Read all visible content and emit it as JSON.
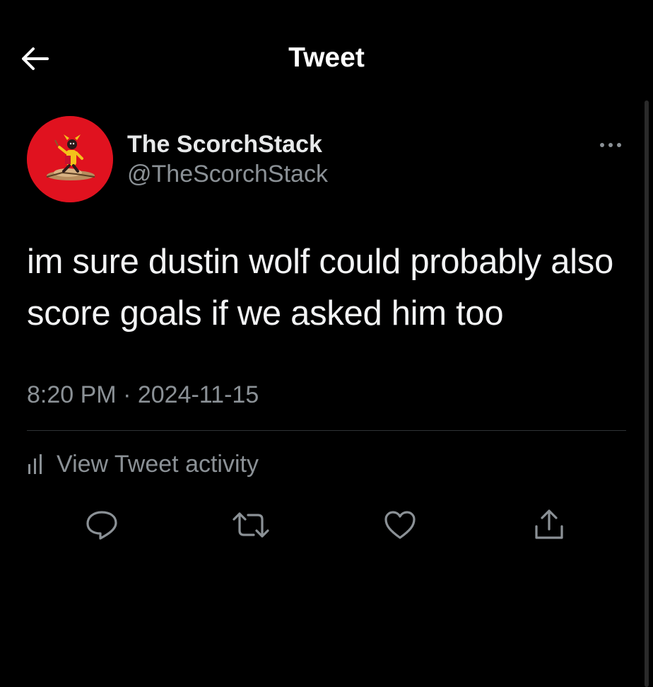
{
  "header": {
    "title": "Tweet",
    "back_icon": "arrow-left-icon"
  },
  "author": {
    "display_name": "The ScorchStack",
    "handle": "@TheScorchStack",
    "avatar_color": "#e0121f"
  },
  "tweet": {
    "text": "im sure dustin wolf could probably also score goals if we asked him too",
    "timestamp": "8:20 PM · 2024-11-15"
  },
  "activity": {
    "label": "View Tweet activity",
    "icon": "bar-chart-icon"
  },
  "actions": {
    "reply_icon": "reply-icon",
    "retweet_icon": "retweet-icon",
    "like_icon": "heart-icon",
    "share_icon": "share-icon"
  },
  "colors": {
    "background": "#000000",
    "primary_text": "#e7e9ea",
    "secondary_text": "#8b9196",
    "divider": "#2f3336"
  }
}
